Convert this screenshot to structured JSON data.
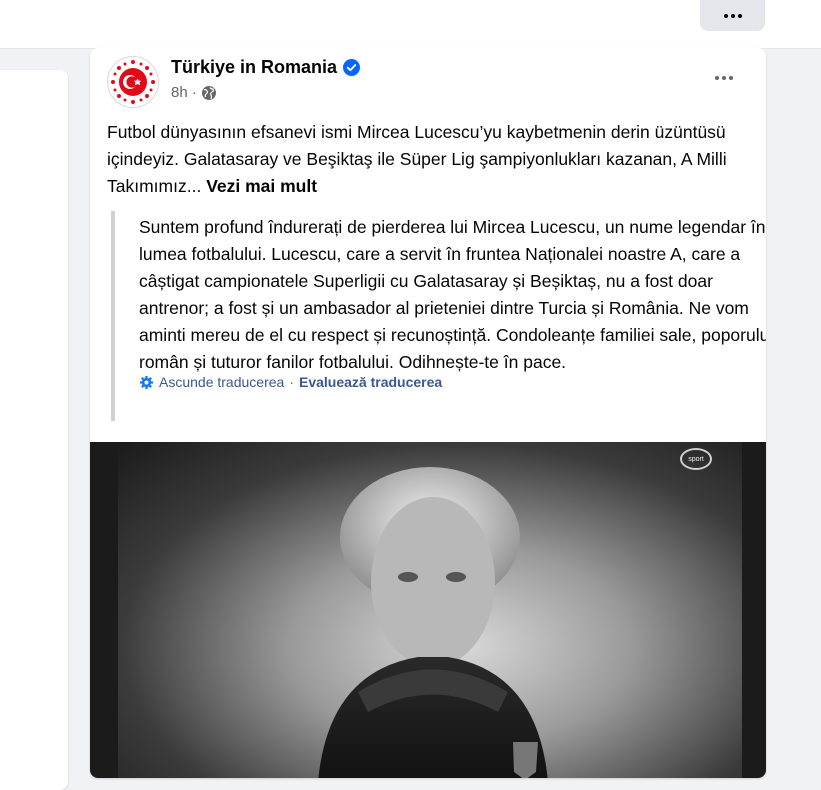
{
  "post": {
    "author": "Türkiye in Romania",
    "time": "8h",
    "meta_separator": "·",
    "text": "Futbol dünyasının efsanevi ismi Mircea Lucescu’yu kaybetmenin derin üzüntüsü içindeyiz. Galatasaray ve Beşiktaş ile Süper Lig şampiyonlukları kazanan, A Milli Takımımız...",
    "see_more": "Vezi mai mult",
    "translation": "Suntem profund îndurerați de pierderea lui Mircea Lucescu, un nume legendar în lumea fotbalului. Lucescu, care a servit în fruntea Naționalei noastre A, care a câștigat campionatele Superligii cu Galatasaray și Beșiktaș, nu a fost doar antrenor; a fost și un ambasador al prieteniei dintre Turcia și România. Ne vom aminti mereu de el cu respect și recunoștință. Condoleanțe familiei sale, poporului român și tuturor fanilor fotbalului. Odihnește-te în pace.",
    "hide_translation": "Ascunde traducerea",
    "rate_translation": "Evaluează traducerea",
    "translation_separator": "·"
  },
  "photo": {
    "channel_logo": "sport"
  },
  "icons": {
    "top_more": "more-dots-icon",
    "post_more": "more-dots-icon",
    "verified": "verified-badge-icon",
    "audience": "globe-icon",
    "translation": "gear-icon",
    "avatar": "turkish-emblem-icon"
  },
  "colors": {
    "accent": "#0866ff",
    "link": "#385898",
    "emblem_red": "#e30a17"
  }
}
